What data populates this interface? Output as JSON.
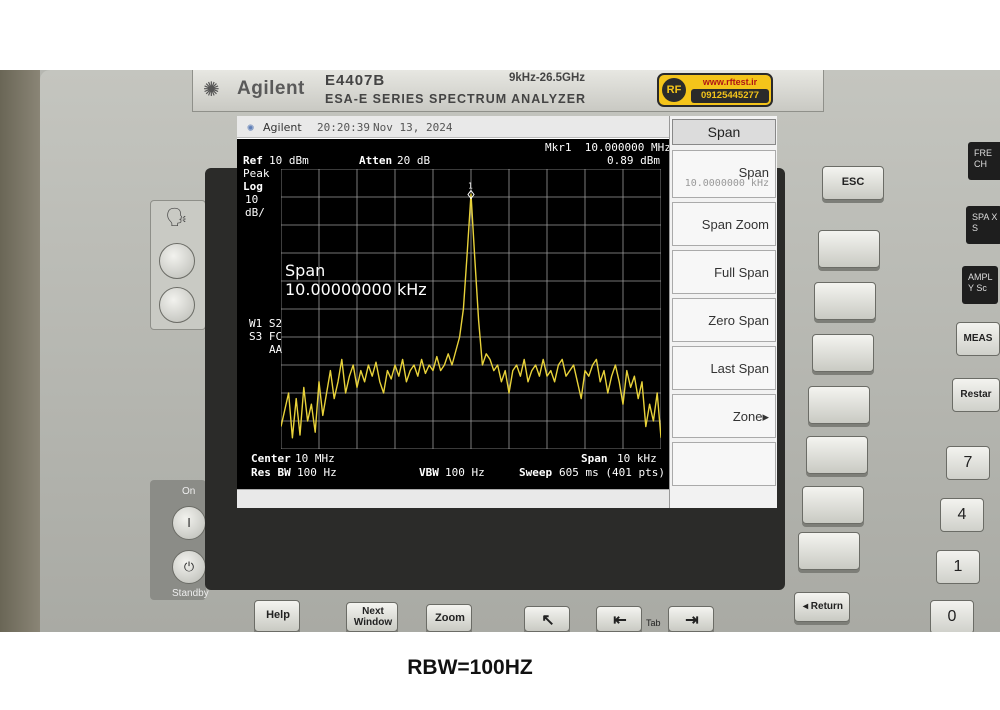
{
  "front_panel": {
    "brand": "Agilent",
    "model": "E4407B",
    "series": "ESA-E SERIES  SPECTRUM ANALYZER",
    "freq_range": "9kHz-26.5GHz",
    "sticker": {
      "logo": "RF",
      "url": "www.rftest.ir",
      "phone": "09125445277"
    },
    "power_label": "On",
    "standby_label": "Standby",
    "esc_label": "ESC",
    "help_label": "Help",
    "next_window_label": "Next Window",
    "zoom_label": "Zoom",
    "tab_label": "Tab",
    "return_label": "◂ Return",
    "right_keys": [
      "FRE CH",
      "SPA X S",
      "AMPL Y Sc",
      "MEAS",
      "Restar"
    ],
    "numpad": [
      "7",
      "4",
      "1",
      "0"
    ]
  },
  "screen": {
    "titlebar": {
      "brand": "Agilent",
      "time": "20:20:39",
      "date": "Nov 13, 2024"
    },
    "annotations": {
      "marker_label": "Mkr1  10.000000 MHz",
      "marker_level": "0.89 dBm",
      "ref_label": "Ref",
      "ref_value": "10 dBm",
      "atten_label": "Atten",
      "atten_value": "20 dB",
      "detector": "Peak",
      "scale_type": "Log",
      "scale_value": "10",
      "scale_unit": "dB/",
      "span_heading": "Span",
      "span_value": "10.00000000 kHz",
      "trace_flags_1": "W1 S2",
      "trace_flags_2": "S3 FC",
      "trace_flags_3": "AA",
      "center_label": "Center",
      "center_value": "10 MHz",
      "span_label": "Span",
      "span_bottom_value": "10 kHz",
      "rbw_label": "Res BW",
      "rbw_value": "100 Hz",
      "vbw_label": "VBW",
      "vbw_value": "100 Hz",
      "sweep_label": "Sweep",
      "sweep_value": "605 ms (401 pts)"
    },
    "softkeys": {
      "title": "Span",
      "items": [
        {
          "label": "Span",
          "sub": "10.0000000 kHz"
        },
        {
          "label": "Span Zoom",
          "sub": ""
        },
        {
          "label": "Full Span",
          "sub": ""
        },
        {
          "label": "Zero Span",
          "sub": ""
        },
        {
          "label": "Last Span",
          "sub": ""
        },
        {
          "label": "Zone▸",
          "sub": ""
        },
        {
          "label": "",
          "sub": ""
        }
      ]
    }
  },
  "chart_data": {
    "type": "line",
    "x_unit": "kHz offset from center",
    "y_unit": "dBm",
    "xlim": [
      -5,
      5
    ],
    "ylim": [
      -90,
      10
    ],
    "grid": true,
    "series": [
      {
        "color": "#e8d23a",
        "x": [
          -5.0,
          -4.8,
          -4.7,
          -4.6,
          -4.5,
          -4.4,
          -4.3,
          -4.2,
          -4.1,
          -4.0,
          -3.9,
          -3.8,
          -3.7,
          -3.6,
          -3.5,
          -3.4,
          -3.3,
          -3.2,
          -3.1,
          -3.0,
          -2.9,
          -2.8,
          -2.7,
          -2.6,
          -2.5,
          -2.4,
          -2.3,
          -2.2,
          -2.1,
          -2.0,
          -1.9,
          -1.8,
          -1.7,
          -1.6,
          -1.5,
          -1.4,
          -1.3,
          -1.2,
          -1.1,
          -1.0,
          -0.9,
          -0.8,
          -0.7,
          -0.6,
          -0.5,
          -0.4,
          -0.3,
          -0.2,
          -0.1,
          0.0,
          0.1,
          0.2,
          0.3,
          0.4,
          0.5,
          0.6,
          0.7,
          0.8,
          0.9,
          1.0,
          1.1,
          1.2,
          1.3,
          1.4,
          1.5,
          1.6,
          1.7,
          1.8,
          1.9,
          2.0,
          2.1,
          2.2,
          2.3,
          2.4,
          2.5,
          2.6,
          2.7,
          2.8,
          2.9,
          3.0,
          3.1,
          3.2,
          3.3,
          3.4,
          3.5,
          3.6,
          3.7,
          3.8,
          3.9,
          4.0,
          4.1,
          4.2,
          4.3,
          4.4,
          4.5,
          4.6,
          4.7,
          4.8,
          4.9,
          5.0
        ],
        "y": [
          -82,
          -70,
          -86,
          -72,
          -85,
          -68,
          -80,
          -74,
          -84,
          -66,
          -78,
          -70,
          -62,
          -72,
          -66,
          -58,
          -70,
          -64,
          -60,
          -68,
          -62,
          -66,
          -60,
          -64,
          -59,
          -66,
          -70,
          -62,
          -65,
          -60,
          -64,
          -58,
          -66,
          -62,
          -60,
          -64,
          -58,
          -63,
          -60,
          -62,
          -57,
          -62,
          -60,
          -56,
          -60,
          -55,
          -50,
          -40,
          -20,
          1,
          -22,
          -44,
          -60,
          -56,
          -58,
          -62,
          -60,
          -66,
          -62,
          -70,
          -62,
          -60,
          -64,
          -58,
          -66,
          -62,
          -60,
          -64,
          -58,
          -64,
          -62,
          -66,
          -60,
          -58,
          -64,
          -62,
          -60,
          -66,
          -72,
          -62,
          -64,
          -60,
          -58,
          -66,
          -62,
          -70,
          -64,
          -60,
          -66,
          -74,
          -62,
          -68,
          -64,
          -72,
          -66,
          -82,
          -74,
          -80,
          -70,
          -86
        ]
      }
    ],
    "marker": {
      "x": 0.0,
      "y": 0.89
    }
  },
  "caption": "RBW=100HZ"
}
